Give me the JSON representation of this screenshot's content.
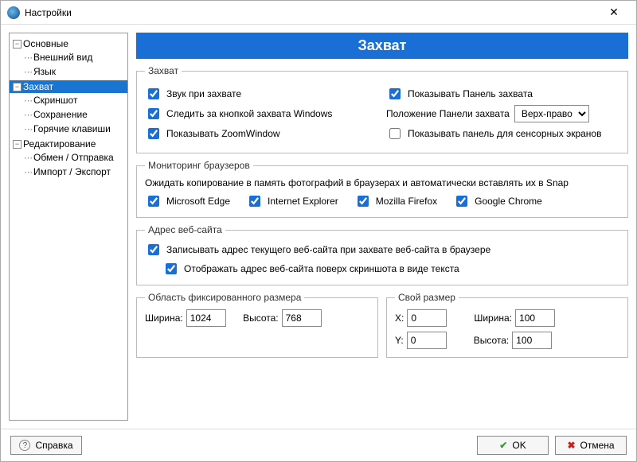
{
  "window": {
    "title": "Настройки"
  },
  "tree": {
    "main": {
      "label": "Основные",
      "children": {
        "appearance": "Внешний вид",
        "language": "Язык"
      }
    },
    "capture": {
      "label": "Захват",
      "children": {
        "screenshot": "Скриншот",
        "saving": "Сохранение",
        "hotkeys": "Горячие клавиши"
      }
    },
    "editing": {
      "label": "Редактирование",
      "children": {
        "share": "Обмен / Отправка",
        "importexport": "Импорт / Экспорт"
      }
    }
  },
  "heading": "Захват",
  "groups": {
    "capture": {
      "legend": "Захват",
      "sound": "Звук при захвате",
      "showPanel": "Показывать Панель захвата",
      "watchKey": "Следить за кнопкой захвата Windows",
      "panelPosLabel": "Положение Панели захвата",
      "panelPosValue": "Верх-право",
      "zoomWindow": "Показывать ZoomWindow",
      "touchPanel": "Показывать панель для сенсорных экранов"
    },
    "browsers": {
      "legend": "Мониторинг браузеров",
      "desc": "Ожидать копирование в память фотографий в браузерах и автоматически вставлять их в Snap",
      "edge": "Microsoft Edge",
      "ie": "Internet Explorer",
      "firefox": "Mozilla Firefox",
      "chrome": "Google Chrome"
    },
    "website": {
      "legend": "Адрес веб-сайта",
      "record": "Записывать адрес текущего веб-сайта при захвате веб-сайта в браузере",
      "overlay": "Отображать адрес веб-сайта поверх скриншота в виде текста"
    },
    "fixed": {
      "legend": "Область фиксированного размера",
      "widthLabel": "Ширина:",
      "widthValue": "1024",
      "heightLabel": "Высота:",
      "heightValue": "768"
    },
    "custom": {
      "legend": "Свой размер",
      "xLabel": "X:",
      "xValue": "0",
      "yLabel": "Y:",
      "yValue": "0",
      "wLabel": "Ширина:",
      "wValue": "100",
      "hLabel": "Высота:",
      "hValue": "100"
    }
  },
  "footer": {
    "help": "Справка",
    "ok": "OK",
    "cancel": "Отмена"
  }
}
